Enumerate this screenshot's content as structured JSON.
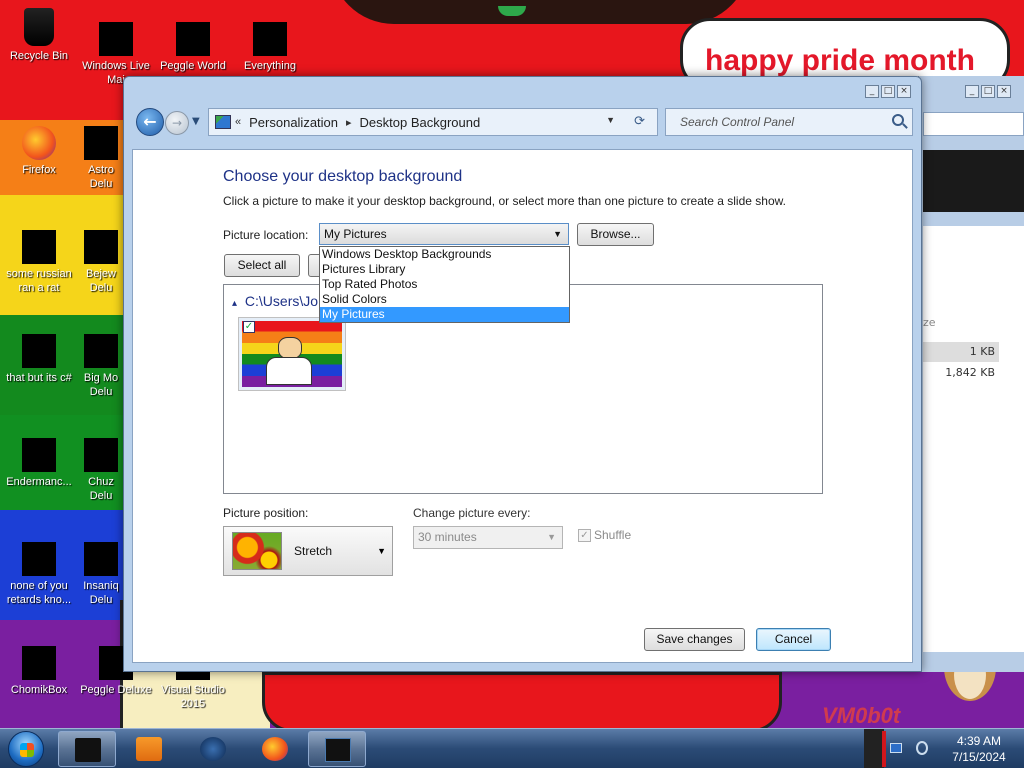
{
  "wallpaper": {
    "bubble_text": "happy pride month",
    "watermark": "VM0b0t"
  },
  "desktop_icons": [
    {
      "label": "Recycle Bin"
    },
    {
      "label": "Windows Live Mai"
    },
    {
      "label": "Peggle World"
    },
    {
      "label": "Everything"
    },
    {
      "label": "Firefox"
    },
    {
      "label": "Astro Delu"
    },
    {
      "label": "some russian ran a rat"
    },
    {
      "label": "Bejew Delu"
    },
    {
      "label": "that but its c#"
    },
    {
      "label": "Big Mo Delu"
    },
    {
      "label": "Endermanc..."
    },
    {
      "label": "Chuz Delu"
    },
    {
      "label": "none of you retards kno..."
    },
    {
      "label": "Insaniq Delu"
    },
    {
      "label": "ChomikBox"
    },
    {
      "label": "Peggle Deluxe"
    },
    {
      "label": "Visual Studio 2015"
    }
  ],
  "bg_window": {
    "col_header": "ze",
    "size1": "1 KB",
    "size2": "1,842 KB"
  },
  "window": {
    "breadcrumb": [
      "Personalization",
      "Desktop Background"
    ],
    "search_placeholder": "Search Control Panel",
    "heading": "Choose your desktop background",
    "subtext": "Click a picture to make it your desktop background, or select more than one picture to create a slide show.",
    "picture_location_label": "Picture location:",
    "picture_location_value": "My Pictures",
    "browse_label": "Browse...",
    "select_all_label": "Select all",
    "dropdown_options": [
      "Windows Desktop Backgrounds",
      "Pictures Library",
      "Top Rated Photos",
      "Solid Colors",
      "My Pictures"
    ],
    "group_path": "C:\\Users\\Jo",
    "picture_position_label": "Picture position:",
    "picture_position_value": "Stretch",
    "change_every_label": "Change picture every:",
    "change_every_value": "30 minutes",
    "shuffle_label": "Shuffle",
    "save_label": "Save changes",
    "cancel_label": "Cancel"
  },
  "taskbar": {
    "time": "4:39 AM",
    "date": "7/15/2024"
  }
}
